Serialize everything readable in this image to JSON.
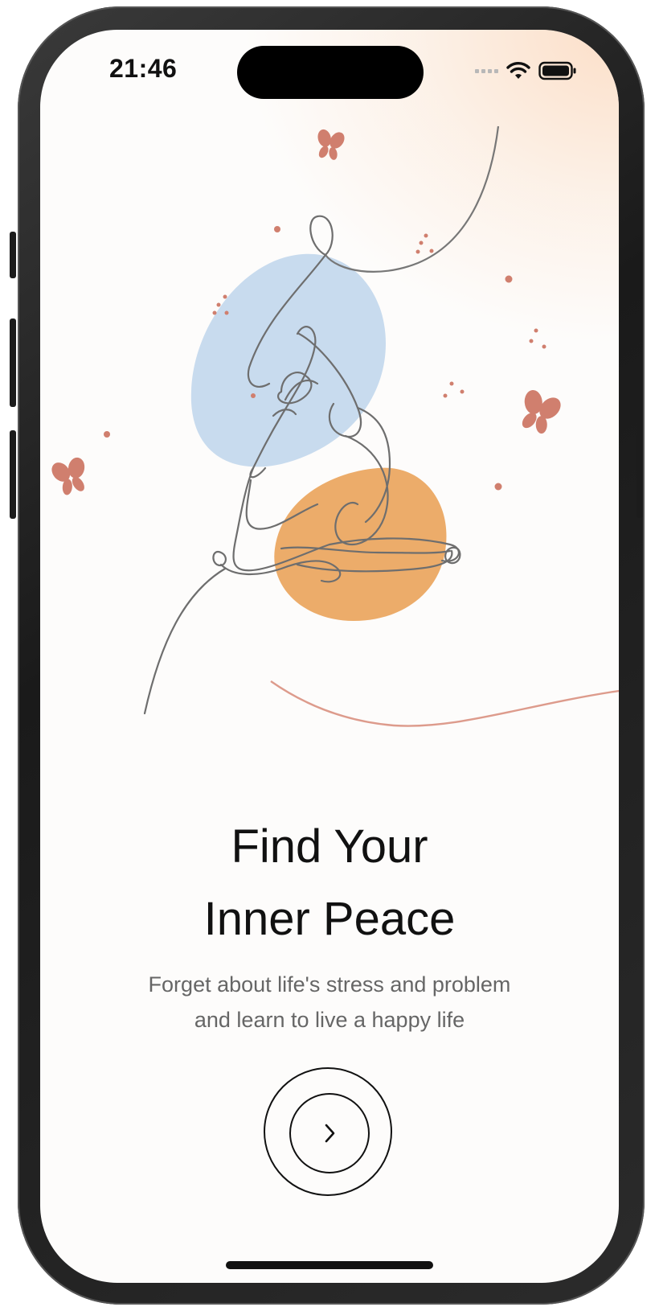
{
  "status_bar": {
    "time": "21:46",
    "icons": [
      "cellular-signal-icon",
      "wifi-icon",
      "battery-icon"
    ]
  },
  "onboarding": {
    "title_line1": "Find Your",
    "title_line2": "Inner Peace",
    "subtitle_line1": "Forget about life's stress and problem",
    "subtitle_line2": "and learn to live a happy life",
    "next_button_icon": "chevron-right-icon"
  },
  "colors": {
    "accent_blue": "#c8dbee",
    "accent_orange": "#ecac6a",
    "butterfly": "#d07f6e",
    "glow": "#fbd5b7"
  }
}
